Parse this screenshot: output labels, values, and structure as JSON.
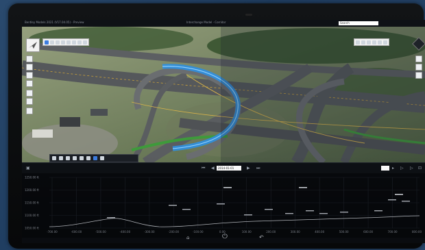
{
  "window": {
    "title_left": "Bentley Models 2021 (V17.04.05) - Preview",
    "title_center": "Interchange Model - Corridor"
  },
  "search": {
    "value": "Search"
  },
  "toolbar_left_count": 8,
  "toolbar_right_count": 6,
  "timeline": {
    "date": "2014-01-01"
  },
  "profile": {
    "y_labels": [
      "1250.00 ft",
      "1200.00 ft",
      "1150.00 ft",
      "1100.00 ft",
      "1050.00 ft"
    ],
    "x_labels": [
      "-700.00",
      "-600.00",
      "-500.00",
      "-400.00",
      "-300.00",
      "-200.00",
      "-100.00",
      "0.00",
      "100.00",
      "200.00",
      "300.00",
      "400.00",
      "500.00",
      "600.00",
      "700.00",
      "800.00"
    ]
  },
  "device_buttons": {
    "home": "⌂",
    "power": "⏻",
    "back": "↶"
  },
  "colors": {
    "accent": "#3c7de0",
    "alignment_blue": "#2f8fe0",
    "profile_line": "#c8ccd2"
  }
}
